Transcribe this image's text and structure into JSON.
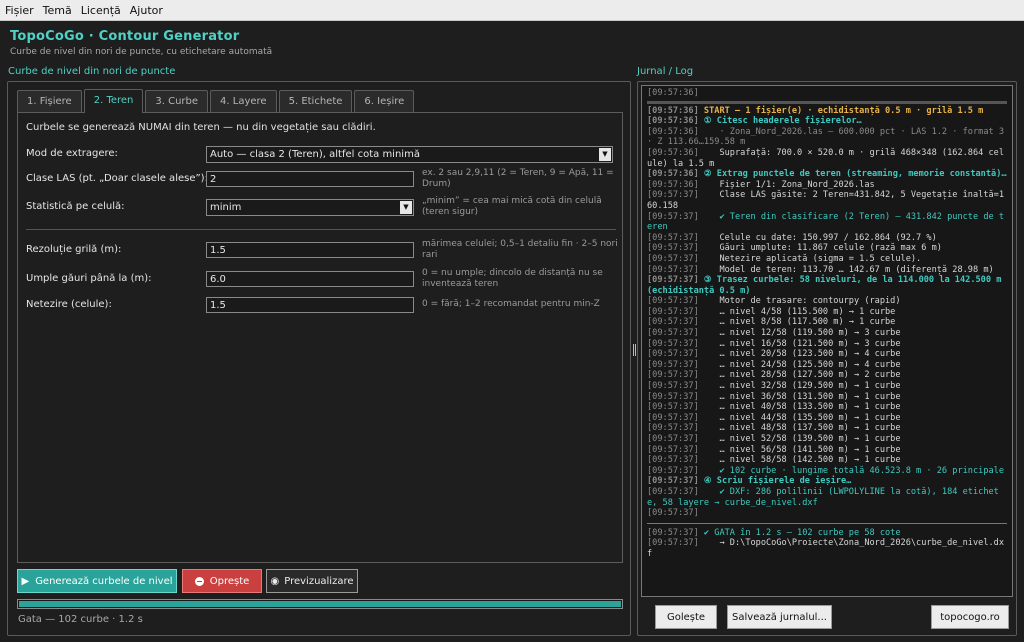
{
  "menu": [
    "Fișier",
    "Temă",
    "Licență",
    "Ajutor"
  ],
  "app": {
    "title": "TopoCoGo · Contour Generator",
    "subtitle": "Curbe de nivel din nori de puncte, cu etichetare automată"
  },
  "left_section_title": "Curbe de nivel din nori de puncte",
  "right_section_title": "Jurnal / Log",
  "tabs": [
    {
      "label": "1. Fișiere",
      "active": false
    },
    {
      "label": "2. Teren",
      "active": true
    },
    {
      "label": "3. Curbe",
      "active": false
    },
    {
      "label": "4. Layere",
      "active": false
    },
    {
      "label": "5. Etichete",
      "active": false
    },
    {
      "label": "6. Ieșire",
      "active": false
    }
  ],
  "form": {
    "note": "Curbele se generează NUMAI din teren — nu din vegetație sau clădiri.",
    "mode_label": "Mod de extragere:",
    "mode_value": "Auto — clasa 2 (Teren), altfel cota minimă",
    "classes_label": "Clase LAS (pt. „Doar clasele alese”):",
    "classes_value": "2",
    "classes_hint": "ex. 2 sau 2,9,11  (2 = Teren, 9 = Apă, 11 = Drum)",
    "stat_label": "Statistică pe celulă:",
    "stat_value": "minim",
    "stat_hint": "„minim” = cea mai mică cotă din celulă (teren sigur)",
    "grid_label": "Rezoluție grilă (m):",
    "grid_value": "1.5",
    "grid_hint": "mărimea celulei; 0,5–1 detaliu fin · 2–5 nori rari",
    "holes_label": "Umple găuri până la (m):",
    "holes_value": "6.0",
    "holes_hint": "0 = nu umple; dincolo de distanță nu se inventează teren",
    "smooth_label": "Netezire (celule):",
    "smooth_value": "1.5",
    "smooth_hint": "0 = fără; 1–2 recomandat pentru min-Z"
  },
  "buttons": {
    "generate": "Generează curbele de nivel",
    "stop": "Oprește",
    "preview": "Previzualizare",
    "clear": "Golește",
    "save_log": "Salvează jurnalul...",
    "site": "topocogo.ro"
  },
  "progress": 1.0,
  "status": "Gata — 102 curbe · 1.2 s",
  "colors": {
    "accent": "#2aa49a",
    "accent_text": "#4fd1c5",
    "stop": "#c9403f",
    "start": "#e8b24a"
  },
  "log": [
    {
      "ts": "[09:57:36]",
      "text": "",
      "type": "dim"
    },
    {
      "rule": "thick"
    },
    {
      "ts": "[09:57:36]",
      "text": "START — 1 fișier(e) · echidistanță 0.5 m · grilă 1.5 m",
      "type": "start"
    },
    {
      "ts": "[09:57:36]",
      "text": "① Citesc headerele fișierelor…",
      "type": "head"
    },
    {
      "ts": "[09:57:36]",
      "text": "   · Zona_Nord_2026.las — 600.000 pct · LAS 1.2 · format 3 · Z 113.66…159.58 m",
      "type": "dim"
    },
    {
      "ts": "[09:57:36]",
      "text": "   Suprafață: 700.0 × 520.0 m · grilă 468×348 (162.864 celule) la 1.5 m",
      "type": "normal"
    },
    {
      "ts": "[09:57:36]",
      "text": "② Extrag punctele de teren (streaming, memorie constantă)…",
      "type": "head"
    },
    {
      "ts": "[09:57:36]",
      "text": "   Fișier 1/1: Zona_Nord_2026.las",
      "type": "normal"
    },
    {
      "ts": "[09:57:37]",
      "text": "   Clase LAS găsite: 2 Teren=431.842, 5 Vegetație înaltă=160.158",
      "type": "normal"
    },
    {
      "ts": "[09:57:37]",
      "text": "   ✔ Teren din clasificare (2 Teren) — 431.842 puncte de teren",
      "type": "ok"
    },
    {
      "ts": "[09:57:37]",
      "text": "   Celule cu date: 150.997 / 162.864 (92.7 %)",
      "type": "normal"
    },
    {
      "ts": "[09:57:37]",
      "text": "   Găuri umplute: 11.867 celule (rază max 6 m)",
      "type": "normal"
    },
    {
      "ts": "[09:57:37]",
      "text": "   Netezire aplicată (sigma = 1.5 celule).",
      "type": "normal"
    },
    {
      "ts": "[09:57:37]",
      "text": "   Model de teren: 113.70 … 142.67 m (diferență 28.98 m)",
      "type": "normal"
    },
    {
      "ts": "[09:57:37]",
      "text": "③ Trasez curbele: 58 niveluri, de la 114.000 la 142.500 m (echidistanță 0.5 m)",
      "type": "head"
    },
    {
      "ts": "[09:57:37]",
      "text": "   Motor de trasare: contourpy (rapid)",
      "type": "normal"
    },
    {
      "ts": "[09:57:37]",
      "text": "   … nivel 4/58 (115.500 m) → 1 curbe",
      "type": "normal"
    },
    {
      "ts": "[09:57:37]",
      "text": "   … nivel 8/58 (117.500 m) → 1 curbe",
      "type": "normal"
    },
    {
      "ts": "[09:57:37]",
      "text": "   … nivel 12/58 (119.500 m) → 3 curbe",
      "type": "normal"
    },
    {
      "ts": "[09:57:37]",
      "text": "   … nivel 16/58 (121.500 m) → 3 curbe",
      "type": "normal"
    },
    {
      "ts": "[09:57:37]",
      "text": "   … nivel 20/58 (123.500 m) → 4 curbe",
      "type": "normal"
    },
    {
      "ts": "[09:57:37]",
      "text": "   … nivel 24/58 (125.500 m) → 4 curbe",
      "type": "normal"
    },
    {
      "ts": "[09:57:37]",
      "text": "   … nivel 28/58 (127.500 m) → 2 curbe",
      "type": "normal"
    },
    {
      "ts": "[09:57:37]",
      "text": "   … nivel 32/58 (129.500 m) → 1 curbe",
      "type": "normal"
    },
    {
      "ts": "[09:57:37]",
      "text": "   … nivel 36/58 (131.500 m) → 1 curbe",
      "type": "normal"
    },
    {
      "ts": "[09:57:37]",
      "text": "   … nivel 40/58 (133.500 m) → 1 curbe",
      "type": "normal"
    },
    {
      "ts": "[09:57:37]",
      "text": "   … nivel 44/58 (135.500 m) → 1 curbe",
      "type": "normal"
    },
    {
      "ts": "[09:57:37]",
      "text": "   … nivel 48/58 (137.500 m) → 1 curbe",
      "type": "normal"
    },
    {
      "ts": "[09:57:37]",
      "text": "   … nivel 52/58 (139.500 m) → 1 curbe",
      "type": "normal"
    },
    {
      "ts": "[09:57:37]",
      "text": "   … nivel 56/58 (141.500 m) → 1 curbe",
      "type": "normal"
    },
    {
      "ts": "[09:57:37]",
      "text": "   … nivel 58/58 (142.500 m) → 1 curbe",
      "type": "normal"
    },
    {
      "ts": "[09:57:37]",
      "text": "   ✔ 102 curbe · lungime totală 46.523.8 m · 26 principale",
      "type": "ok"
    },
    {
      "ts": "[09:57:37]",
      "text": "④ Scriu fișierele de ieșire…",
      "type": "head"
    },
    {
      "ts": "[09:57:37]",
      "text": "   ✔ DXF: 286 polilinii (LWPOLYLINE la cotă), 184 etichete, 58 layere → curbe_de_nivel.dxf",
      "type": "ok"
    },
    {
      "ts": "[09:57:37]",
      "text": "",
      "type": "dim"
    },
    {
      "rule": "thin"
    },
    {
      "ts": "[09:57:37]",
      "text": "✔ GATA în 1.2 s — 102 curbe pe 58 cote",
      "type": "ok"
    },
    {
      "ts": "[09:57:37]",
      "text": "   → D:\\TopoCoGo\\Proiecte\\Zona_Nord_2026\\curbe_de_nivel.dxf",
      "type": "normal"
    }
  ]
}
